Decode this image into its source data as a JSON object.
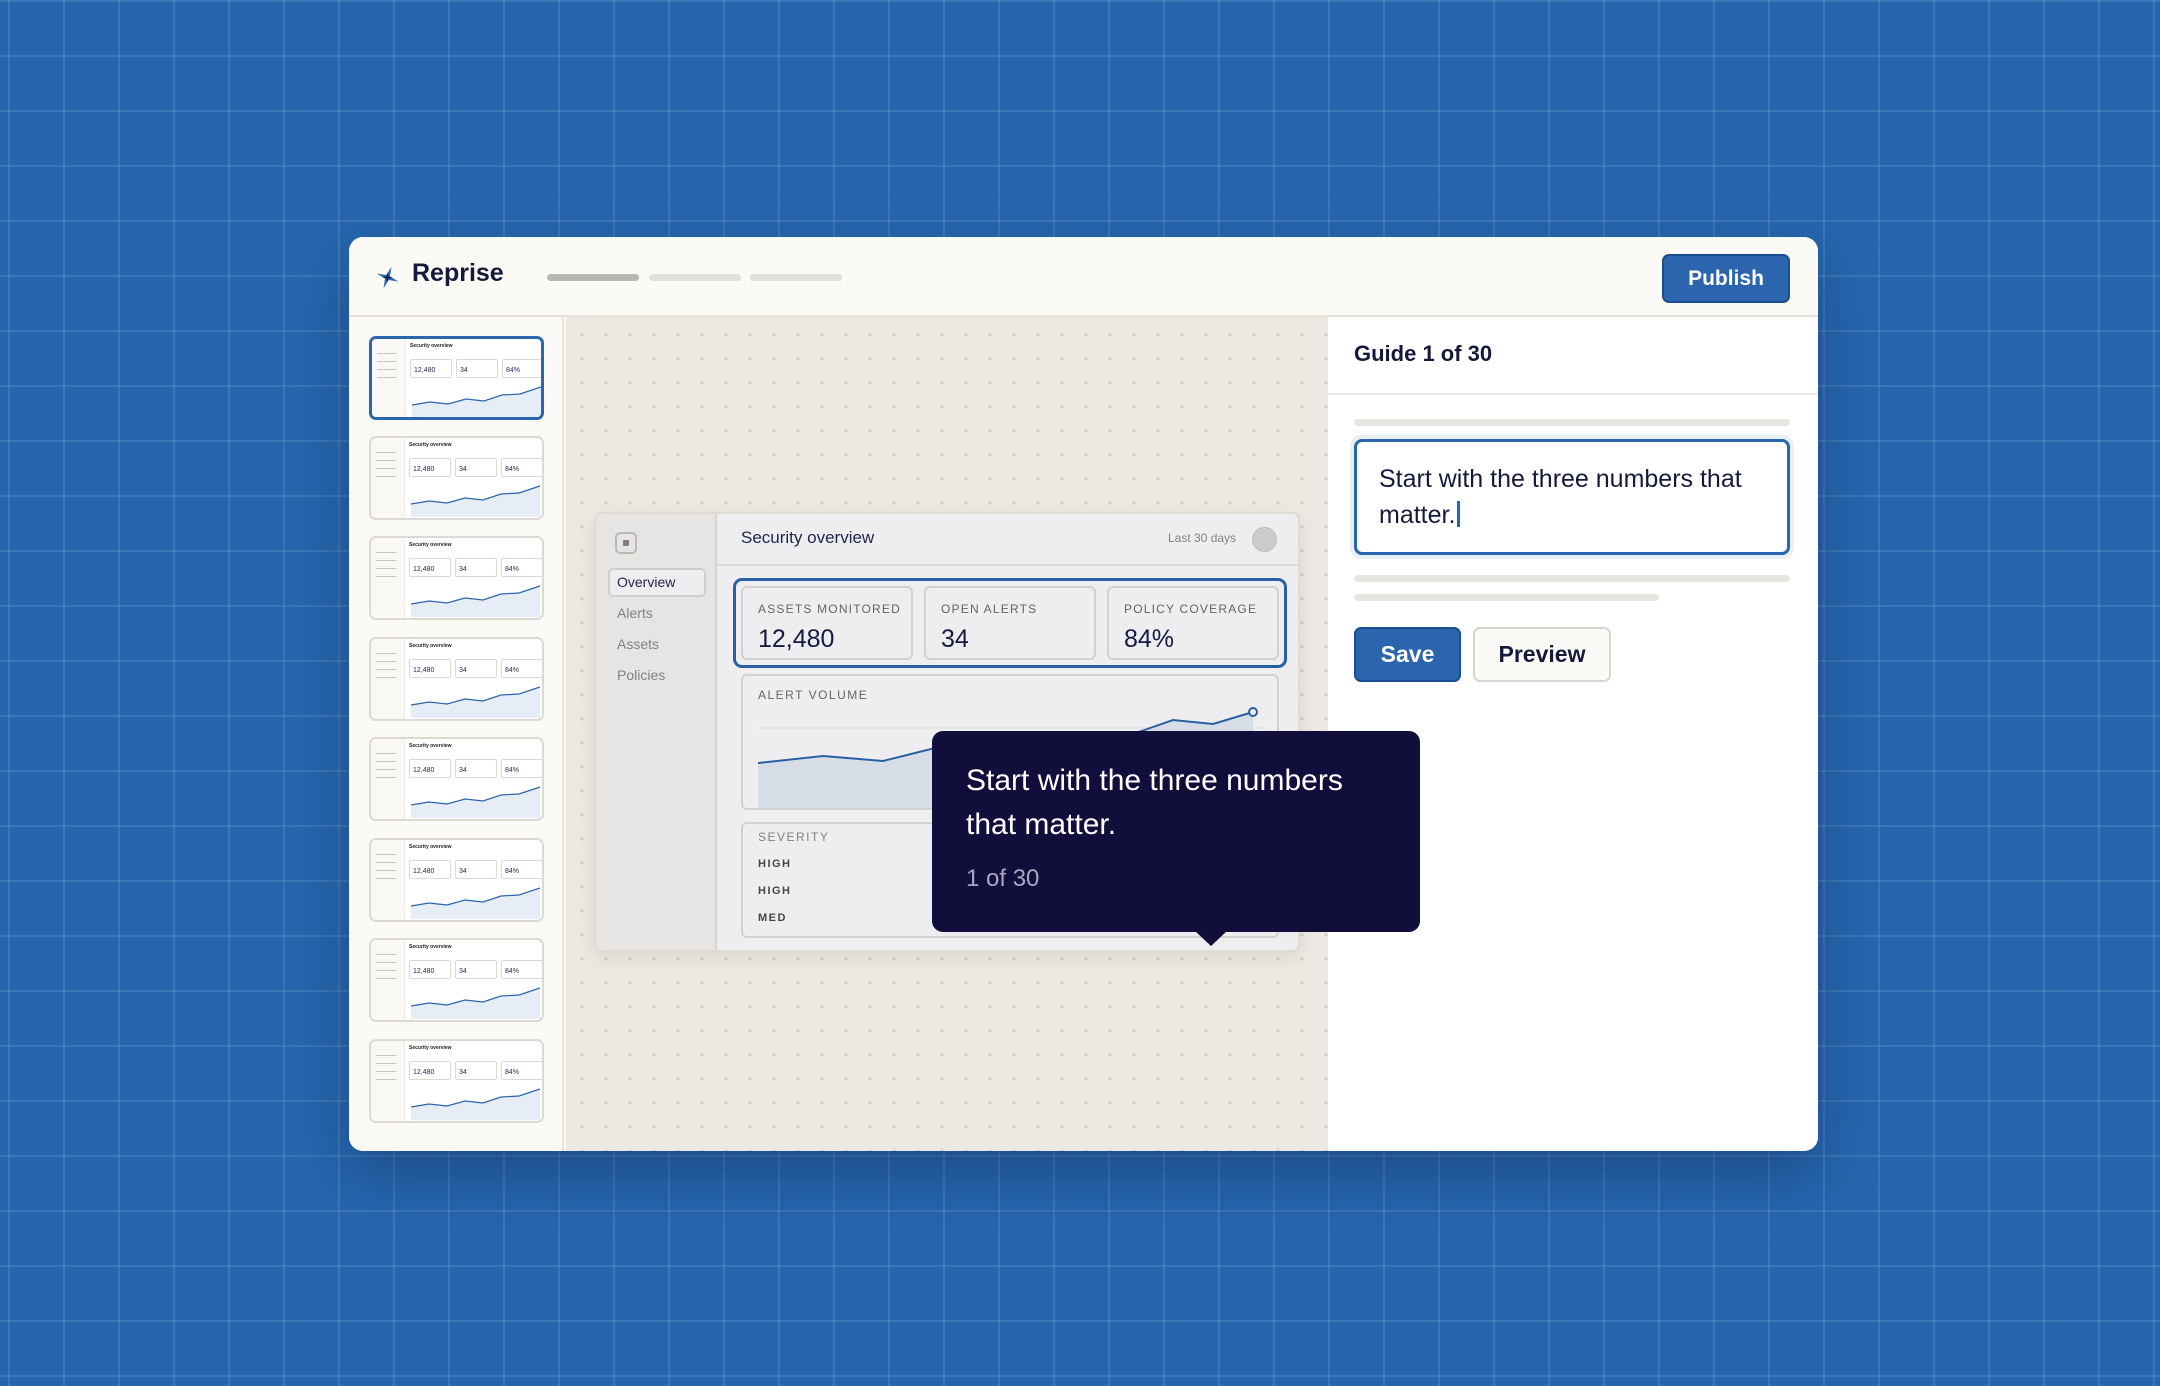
{
  "app": {
    "name": "Reprise",
    "publish_label": "Publish"
  },
  "mini_app": {
    "title": "Security overview",
    "range": "Last 30 days",
    "nav": [
      "Overview",
      "Alerts",
      "Assets",
      "Policies"
    ],
    "kpis": [
      {
        "label": "ASSETS MONITORED",
        "value": "12,480"
      },
      {
        "label": "OPEN ALERTS",
        "value": "34"
      },
      {
        "label": "POLICY COVERAGE",
        "value": "84%"
      }
    ],
    "alert_volume_label": "ALERT VOLUME",
    "severity_label": "SEVERITY",
    "severity_rows": [
      "HIGH",
      "HIGH",
      "MED"
    ]
  },
  "tooltip": {
    "text": "Start with the three numbers that matter.",
    "count": "1 of 30"
  },
  "panel": {
    "title": "Guide 1 of 30",
    "field_value": "Start with the three numbers that matter.",
    "save_label": "Save",
    "preview_label": "Preview"
  },
  "colors": {
    "accent": "#2a65ad",
    "tooltip_bg": "#110e3c",
    "background": "#2766ae"
  }
}
